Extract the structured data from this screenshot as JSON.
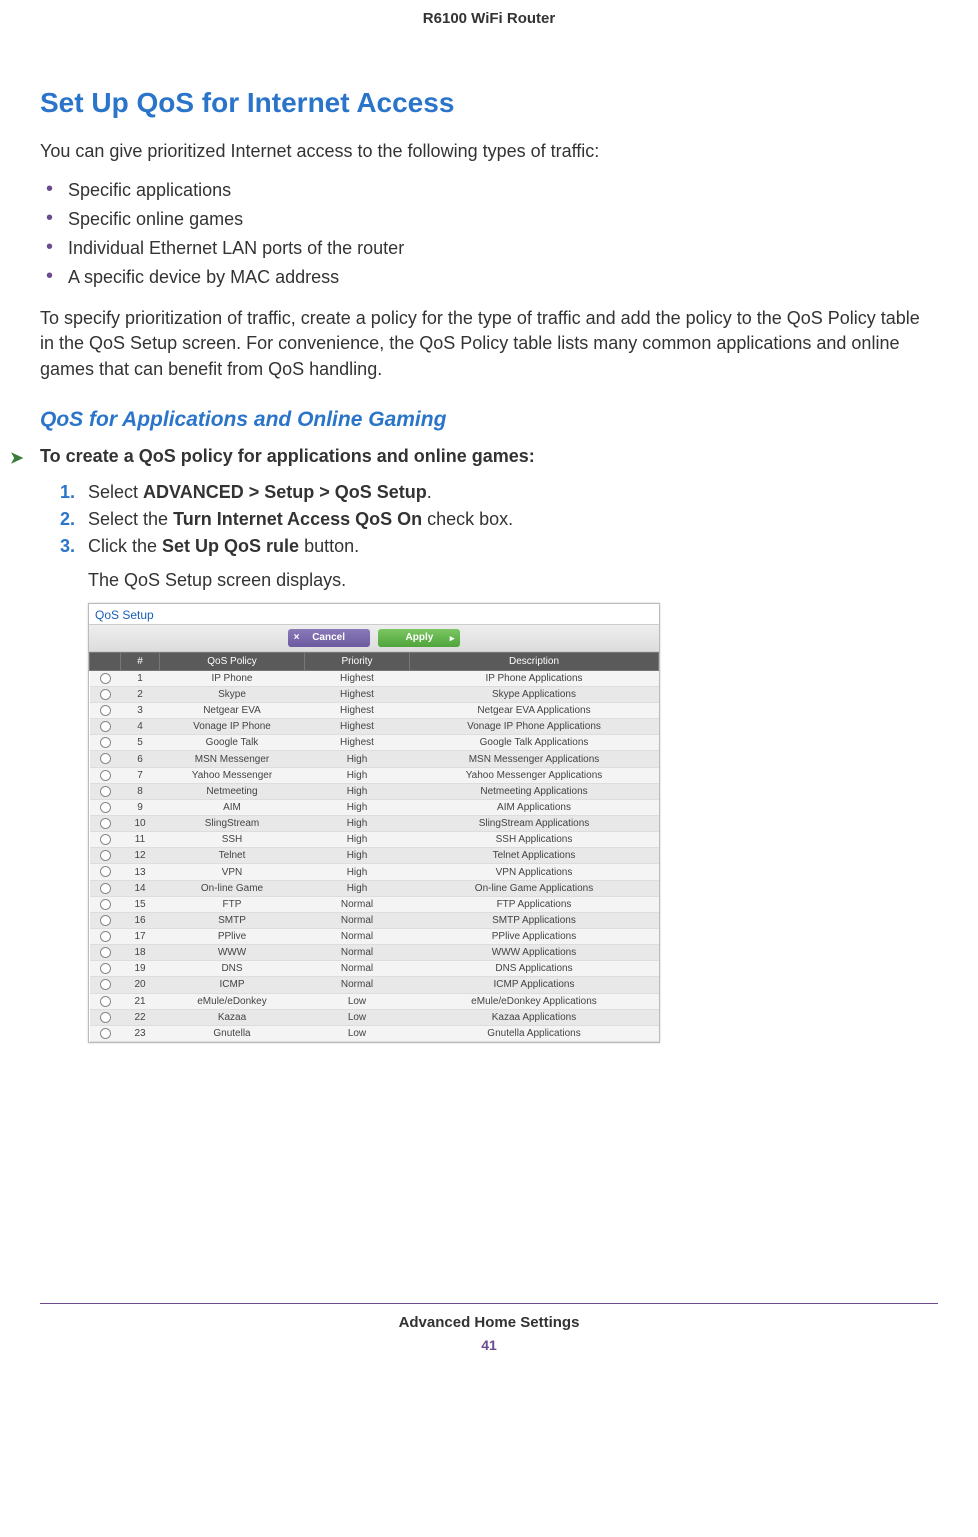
{
  "header": {
    "product": "R6100 WiFi Router"
  },
  "section": {
    "title": "Set Up QoS for Internet Access",
    "intro": "You can give prioritized Internet access to the following types of traffic:",
    "bullets": [
      "Specific applications",
      "Specific online games",
      "Individual Ethernet LAN ports of the router",
      "A specific device by MAC address"
    ],
    "para2": "To specify prioritization of traffic, create a policy for the type of traffic and add the policy to the QoS Policy table in the QoS Setup screen. For convenience, the QoS Policy table lists many common applications and online games that can benefit from QoS handling."
  },
  "subsection": {
    "title": "QoS for Applications and Online Gaming",
    "proc_heading": "To create a QoS policy for applications and online games:",
    "steps": [
      {
        "pre": "Select ",
        "bold": "ADVANCED > Setup > QoS Setup",
        "post": "."
      },
      {
        "pre": "Select the ",
        "bold": "Turn Internet Access QoS On",
        "post": " check box."
      },
      {
        "pre": "Click the ",
        "bold": "Set Up QoS rule",
        "post": " button."
      }
    ],
    "followup": "The QoS Setup screen displays."
  },
  "screenshot": {
    "title": "QoS Setup",
    "buttons": {
      "cancel": "Cancel",
      "apply": "Apply"
    },
    "columns": {
      "num": "#",
      "policy": "QoS Policy",
      "priority": "Priority",
      "desc": "Description"
    },
    "rows": [
      {
        "n": "1",
        "policy": "IP Phone",
        "prio": "Highest",
        "desc": "IP Phone Applications"
      },
      {
        "n": "2",
        "policy": "Skype",
        "prio": "Highest",
        "desc": "Skype Applications"
      },
      {
        "n": "3",
        "policy": "Netgear EVA",
        "prio": "Highest",
        "desc": "Netgear EVA Applications"
      },
      {
        "n": "4",
        "policy": "Vonage IP Phone",
        "prio": "Highest",
        "desc": "Vonage IP Phone Applications"
      },
      {
        "n": "5",
        "policy": "Google Talk",
        "prio": "Highest",
        "desc": "Google Talk Applications"
      },
      {
        "n": "6",
        "policy": "MSN Messenger",
        "prio": "High",
        "desc": "MSN Messenger Applications"
      },
      {
        "n": "7",
        "policy": "Yahoo Messenger",
        "prio": "High",
        "desc": "Yahoo Messenger Applications"
      },
      {
        "n": "8",
        "policy": "Netmeeting",
        "prio": "High",
        "desc": "Netmeeting Applications"
      },
      {
        "n": "9",
        "policy": "AIM",
        "prio": "High",
        "desc": "AIM Applications"
      },
      {
        "n": "10",
        "policy": "SlingStream",
        "prio": "High",
        "desc": "SlingStream Applications"
      },
      {
        "n": "11",
        "policy": "SSH",
        "prio": "High",
        "desc": "SSH Applications"
      },
      {
        "n": "12",
        "policy": "Telnet",
        "prio": "High",
        "desc": "Telnet Applications"
      },
      {
        "n": "13",
        "policy": "VPN",
        "prio": "High",
        "desc": "VPN Applications"
      },
      {
        "n": "14",
        "policy": "On-line Game",
        "prio": "High",
        "desc": "On-line Game Applications"
      },
      {
        "n": "15",
        "policy": "FTP",
        "prio": "Normal",
        "desc": "FTP Applications"
      },
      {
        "n": "16",
        "policy": "SMTP",
        "prio": "Normal",
        "desc": "SMTP Applications"
      },
      {
        "n": "17",
        "policy": "PPlive",
        "prio": "Normal",
        "desc": "PPlive Applications"
      },
      {
        "n": "18",
        "policy": "WWW",
        "prio": "Normal",
        "desc": "WWW Applications"
      },
      {
        "n": "19",
        "policy": "DNS",
        "prio": "Normal",
        "desc": "DNS Applications"
      },
      {
        "n": "20",
        "policy": "ICMP",
        "prio": "Normal",
        "desc": "ICMP Applications"
      },
      {
        "n": "21",
        "policy": "eMule/eDonkey",
        "prio": "Low",
        "desc": "eMule/eDonkey Applications"
      },
      {
        "n": "22",
        "policy": "Kazaa",
        "prio": "Low",
        "desc": "Kazaa Applications"
      },
      {
        "n": "23",
        "policy": "Gnutella",
        "prio": "Low",
        "desc": "Gnutella Applications"
      }
    ]
  },
  "footer": {
    "section": "Advanced Home Settings",
    "page": "41"
  }
}
